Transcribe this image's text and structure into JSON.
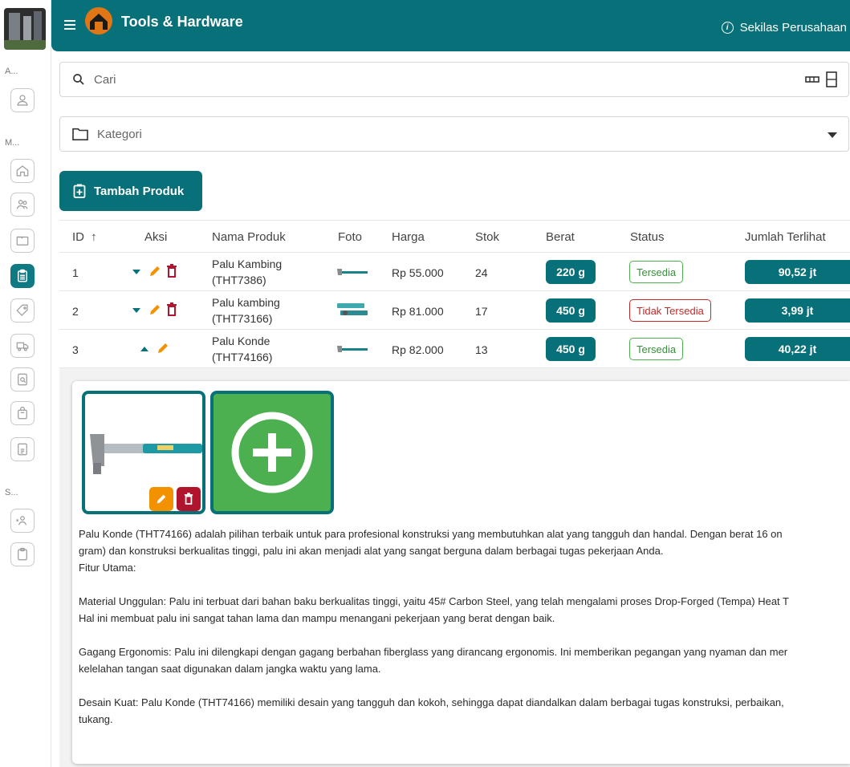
{
  "header": {
    "title": "Tools & Hardware",
    "about_label": "Sekilas Perusahaan"
  },
  "rail": {
    "sections": [
      "A...",
      "M...",
      "S..."
    ],
    "items": [
      "user-icon",
      "home-icon",
      "users-icon",
      "folder-icon",
      "clipboard-icon",
      "tag-icon",
      "truck-icon",
      "search-doc-icon",
      "bag-icon",
      "document-icon",
      "people-icon",
      "clipboard-blank-icon"
    ]
  },
  "search": {
    "placeholder": "Cari"
  },
  "category": {
    "placeholder": "Kategori"
  },
  "add_button": {
    "label": "Tambah Produk"
  },
  "table": {
    "columns": [
      "ID",
      "Aksi",
      "Nama Produk",
      "Foto",
      "Harga",
      "Stok",
      "Berat",
      "Status",
      "Jumlah Terlihat"
    ],
    "sort_indicator": "↑",
    "rows": [
      {
        "id": "1",
        "name_line1": "Palu Kambing",
        "name_line2": "(THT7386)",
        "price": "Rp 55.000",
        "stock": "24",
        "weight": "220 g",
        "status": "Tersedia",
        "status_ok": true,
        "views": "90,52 jt"
      },
      {
        "id": "2",
        "name_line1": "Palu kambing",
        "name_line2": "(THT73166)",
        "price": "Rp 81.000",
        "stock": "17",
        "weight": "450 g",
        "status": "Tidak Tersedia",
        "status_ok": false,
        "views": "3,99 jt"
      },
      {
        "id": "3",
        "name_line1": "Palu Konde",
        "name_line2": "(THT74166)",
        "price": "Rp 82.000",
        "stock": "13",
        "weight": "450 g",
        "status": "Tersedia",
        "status_ok": true,
        "views": "40,22 jt"
      }
    ]
  },
  "detail": {
    "lines": [
      "Palu Konde (THT74166) adalah pilihan terbaik untuk para profesional konstruksi yang membutuhkan alat yang tangguh dan handal. Dengan berat 16 on",
      "gram) dan konstruksi berkualitas tinggi, palu ini akan menjadi alat yang sangat berguna dalam berbagai tugas pekerjaan Anda.",
      "Fitur Utama:",
      "",
      "Material Unggulan: Palu ini terbuat dari bahan baku berkualitas tinggi, yaitu 45# Carbon Steel, yang telah mengalami proses Drop-Forged (Tempa) Heat T",
      "Hal ini membuat palu ini sangat tahan lama dan mampu menangani pekerjaan yang berat dengan baik.",
      "",
      "Gagang Ergonomis: Palu ini dilengkapi dengan gagang berbahan fiberglass yang dirancang ergonomis. Ini memberikan pegangan yang nyaman dan mer",
      "kelelahan tangan saat digunakan dalam jangka waktu yang lama.",
      "",
      "Desain Kuat: Palu Konde (THT74166) memiliki desain yang tangguh dan kokoh, sehingga dapat diandalkan dalam berbagai tugas konstruksi, perbaikan,",
      "tukang."
    ]
  },
  "colors": {
    "primary": "#087078",
    "edit": "#f39200",
    "delete": "#b0152d",
    "available": "#4caf50",
    "unavailable": "#c62828"
  }
}
